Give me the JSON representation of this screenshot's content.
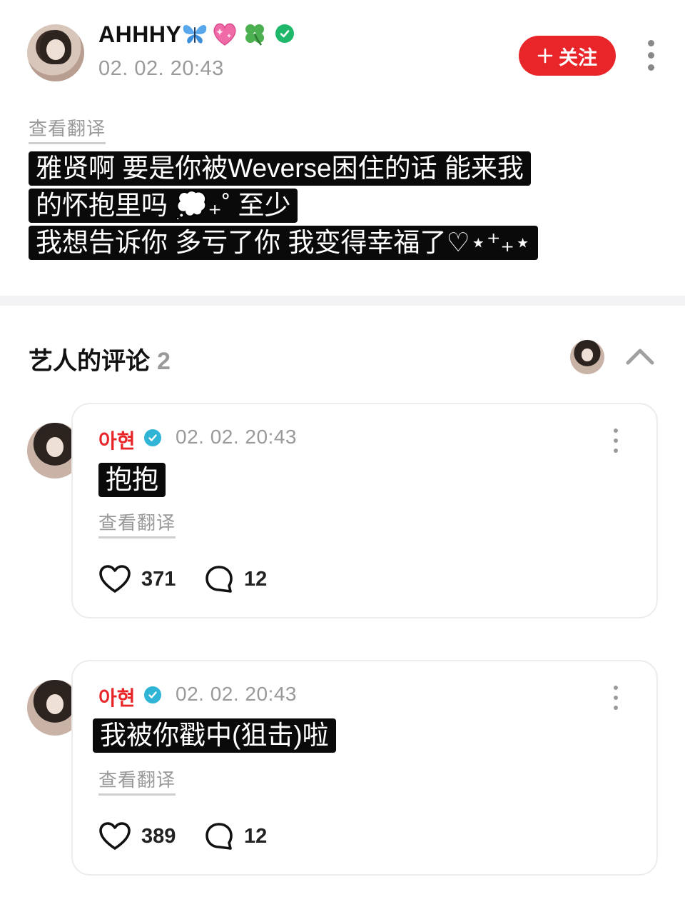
{
  "post": {
    "author": {
      "name": "AHHHY",
      "emojis": [
        "butterfly-icon",
        "sparkling-heart-icon",
        "four-leaf-clover-icon",
        "verified-green-icon"
      ]
    },
    "time": "02. 02. 20:43",
    "follow_label": "关注",
    "translate_label": "查看翻译",
    "body_lines": [
      "雅贤啊 要是你被Weverse困住的话 能来我",
      "的怀抱里吗 💭₊˚ 至少",
      "我想告诉你 多亏了你 我变得幸福了♡⋆⁺₊⋆"
    ]
  },
  "artist_comments": {
    "title": "艺人的评论",
    "count": "2",
    "items": [
      {
        "name": "아현",
        "time": "02. 02. 20:43",
        "text": "抱抱",
        "translate_label": "查看翻译",
        "likes": "371",
        "replies": "12"
      },
      {
        "name": "아현",
        "time": "02. 02. 20:43",
        "text": "我被你戳中(狙击)啦",
        "translate_label": "查看翻译",
        "likes": "389",
        "replies": "12"
      }
    ]
  },
  "colors": {
    "accent_red": "#e8262a",
    "verified_blue": "#2fb4d6",
    "verified_green": "#1fb86a",
    "muted_text": "#9a9a9a",
    "highlight_bg": "#0a0a0a"
  }
}
